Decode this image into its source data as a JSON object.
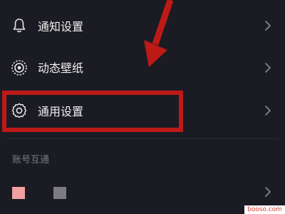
{
  "colors": {
    "background": "#1b1b23",
    "text": "#f0f0f0",
    "muted": "#7b7b85",
    "annotation_red": "#bd1a17",
    "swatch_pink": "#f2a0a0",
    "swatch_gray": "#7c7c80"
  },
  "settings": {
    "items": [
      {
        "label": "通知设置",
        "icon": "bell-icon"
      },
      {
        "label": "动态壁纸",
        "icon": "wallpaper-icon"
      },
      {
        "label": "通用设置",
        "icon": "gear-icon"
      }
    ],
    "section_title": "账号互通",
    "linked_accounts": [
      {
        "icon": "account-pink-icon",
        "color": "#f2a0a0"
      },
      {
        "icon": "account-gray-icon",
        "color": "#7c7c80"
      }
    ]
  },
  "annotation": {
    "highlighted_item": "通用设置"
  },
  "watermark": {
    "text": "booso.com"
  }
}
